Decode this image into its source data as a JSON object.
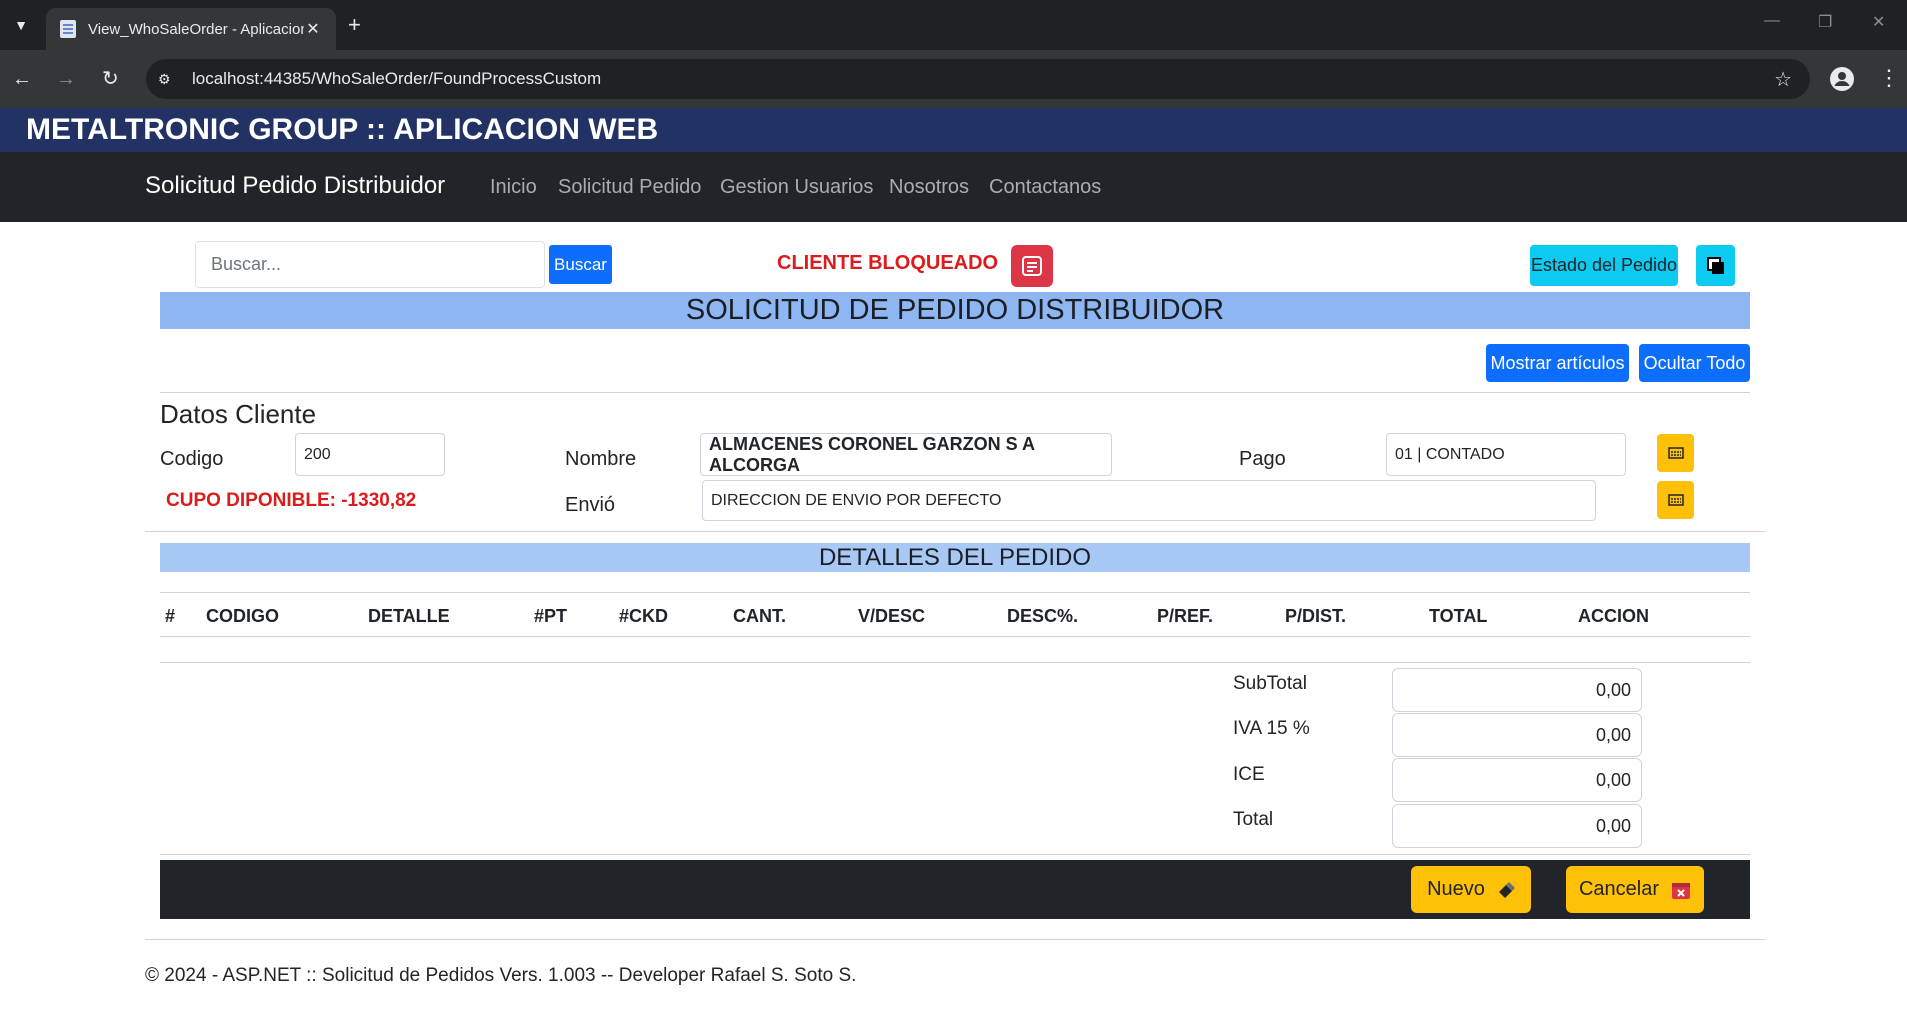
{
  "browser": {
    "tab_title": "View_WhoSaleOrder - Aplicacion",
    "url": "localhost:44385/WhoSaleOrder/FoundProcessCustom"
  },
  "header": {
    "brand": "METALTRONIC GROUP :: APLICACION WEB"
  },
  "navbar": {
    "brand": "Solicitud Pedido Distribuidor",
    "links": [
      "Inicio",
      "Solicitud Pedido",
      "Gestion Usuarios",
      "Nosotros",
      "Contactanos"
    ]
  },
  "toolbar": {
    "search_placeholder": "Buscar...",
    "search_button": "Buscar",
    "blocked_label": "CLIENTE BLOQUEADO",
    "estado_button": "Estado del Pedido"
  },
  "main": {
    "title": "SOLICITUD DE PEDIDO DISTRIBUIDOR",
    "show_items_button": "Mostrar artículos",
    "hide_all_button": "Ocultar Todo"
  },
  "cliente": {
    "section_title": "Datos Cliente",
    "codigo_label": "Codigo",
    "codigo_value": "200",
    "nombre_label": "Nombre",
    "nombre_value": "ALMACENES CORONEL GARZON S A ALCORGA",
    "pago_label": "Pago",
    "pago_value": "01 | CONTADO",
    "cupo_text": "CUPO DIPONIBLE: -1330,82",
    "envio_label": "Envió",
    "envio_value": "DIRECCION DE ENVIO POR DEFECTO"
  },
  "detalles": {
    "title": "DETALLES DEL PEDIDO",
    "columns": [
      "#",
      "CODIGO",
      "DETALLE",
      "#PT",
      "#CKD",
      "CANT.",
      "V/DESC",
      "DESC%.",
      "P/REF.",
      "P/DIST.",
      "TOTAL",
      "ACCION"
    ]
  },
  "totales": {
    "subtotal_label": "SubTotal",
    "subtotal_value": "0,00",
    "iva_label": "IVA 15 %",
    "iva_value": "0,00",
    "ice_label": "ICE",
    "ice_value": "0,00",
    "total_label": "Total",
    "total_value": "0,00"
  },
  "actions": {
    "nuevo_label": "Nuevo",
    "cancelar_label": "Cancelar"
  },
  "footer": {
    "text": "© 2024 - ASP.NET :: Solicitud de Pedidos Vers. 1.003 -- Developer Rafael S. Soto S."
  },
  "colors": {
    "brand_bar": "#223265",
    "navbar": "#212529",
    "primary": "#0d6efd",
    "info": "#0dcaf0",
    "warning": "#ffc107",
    "danger": "#dc3545",
    "title_band": "#8eb6f2"
  }
}
